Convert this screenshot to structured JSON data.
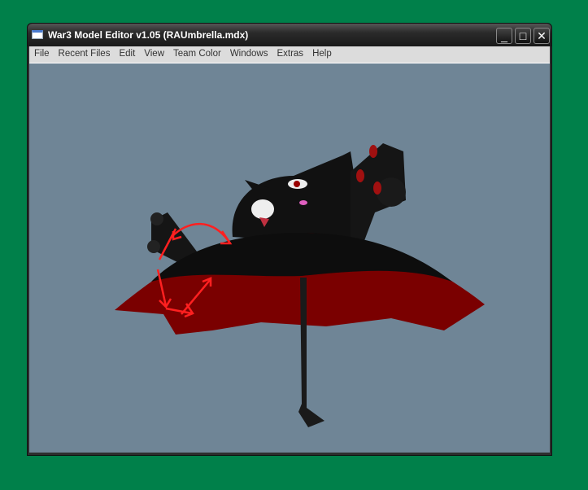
{
  "window": {
    "title": "War3 Model Editor v1.05 (RAUmbrella.mdx)",
    "buttons": {
      "minimize": "_",
      "maximize": "□",
      "close": "✕"
    }
  },
  "menu": [
    "File",
    "Recent Files",
    "Edit",
    "View",
    "Team Color",
    "Windows",
    "Extras",
    "Help"
  ],
  "colors": {
    "background": "#00804a",
    "viewport": "#6f8596",
    "annotation": "#ff2020"
  }
}
